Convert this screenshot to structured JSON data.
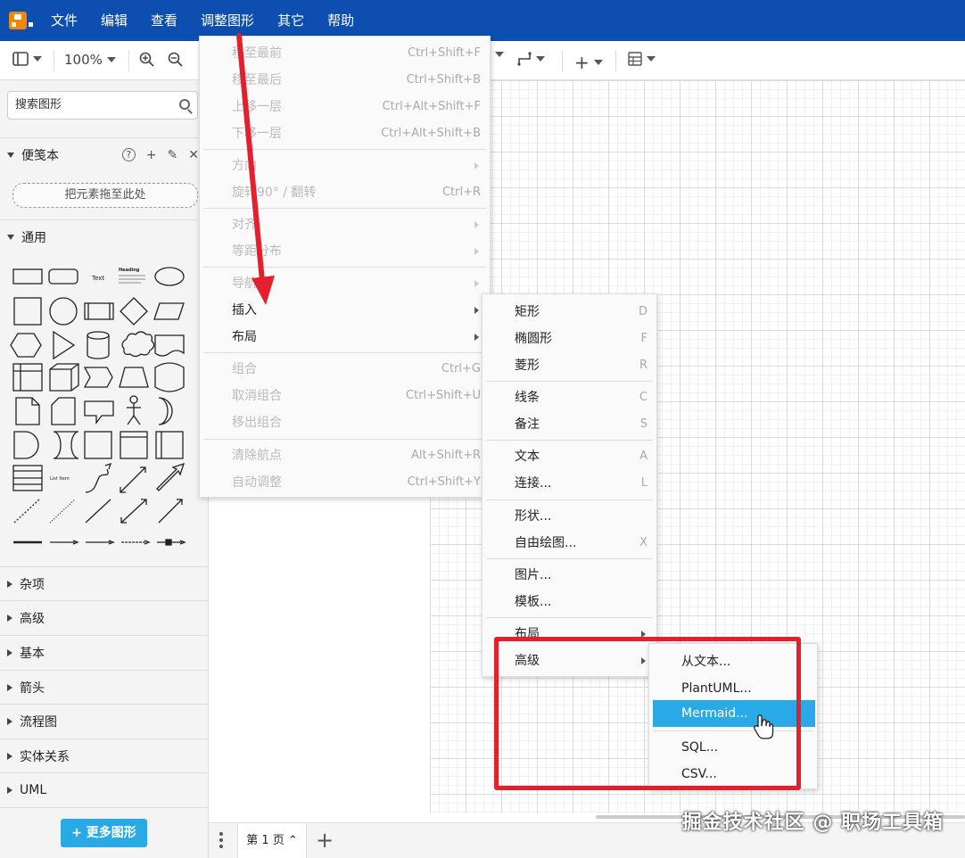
{
  "menubar": {
    "items": [
      "文件",
      "编辑",
      "查看",
      "调整图形",
      "其它",
      "帮助"
    ]
  },
  "toolbar": {
    "zoom": "100%"
  },
  "sidebar": {
    "search_placeholder": "搜索图形",
    "scratchpad_title": "便笺本",
    "dropzone_text": "把元素拖至此处",
    "general_title": "通用",
    "shape_text": "Text",
    "shape_heading": "Heading",
    "shape_list_item": "List Item",
    "sections": [
      "杂项",
      "高级",
      "基本",
      "箭头",
      "流程图",
      "实体关系",
      "UML"
    ],
    "more_shapes": "+ 更多图形"
  },
  "arrange_menu": {
    "items": [
      {
        "label": "移至最前",
        "shortcut": "Ctrl+Shift+F",
        "disabled": true
      },
      {
        "label": "移至最后",
        "shortcut": "Ctrl+Shift+B",
        "disabled": true
      },
      {
        "label": "上移一层",
        "shortcut": "Ctrl+Alt+Shift+F",
        "disabled": true
      },
      {
        "label": "下移一层",
        "shortcut": "Ctrl+Alt+Shift+B",
        "disabled": true
      },
      {
        "label": "方向",
        "shortcut": "",
        "disabled": true
      },
      {
        "label": "旋转90° / 翻转",
        "shortcut": "Ctrl+R",
        "disabled": true
      },
      {
        "label": "对齐",
        "shortcut": "",
        "disabled": true
      },
      {
        "label": "等距分布",
        "shortcut": "",
        "disabled": true
      },
      {
        "label": "导航",
        "shortcut": "",
        "disabled": true
      },
      {
        "label": "插入",
        "shortcut": "",
        "disabled": false
      },
      {
        "label": "布局",
        "shortcut": "",
        "disabled": false
      },
      {
        "label": "组合",
        "shortcut": "Ctrl+G",
        "disabled": true
      },
      {
        "label": "取消组合",
        "shortcut": "Ctrl+Shift+U",
        "disabled": true
      },
      {
        "label": "移出组合",
        "shortcut": "",
        "disabled": true
      },
      {
        "label": "清除航点",
        "shortcut": "Alt+Shift+R",
        "disabled": true
      },
      {
        "label": "自动调整",
        "shortcut": "Ctrl+Shift+Y",
        "disabled": true
      }
    ]
  },
  "insert_menu": {
    "items": [
      {
        "label": "矩形",
        "shortcut": "D"
      },
      {
        "label": "椭圆形",
        "shortcut": "F"
      },
      {
        "label": "菱形",
        "shortcut": "R"
      },
      {
        "label": "线条",
        "shortcut": "C"
      },
      {
        "label": "备注",
        "shortcut": "S"
      },
      {
        "label": "文本",
        "shortcut": "A"
      },
      {
        "label": "连接...",
        "shortcut": "L"
      },
      {
        "label": "形状...",
        "shortcut": ""
      },
      {
        "label": "自由绘图...",
        "shortcut": "X"
      },
      {
        "label": "图片...",
        "shortcut": ""
      },
      {
        "label": "模板...",
        "shortcut": ""
      },
      {
        "label": "布局",
        "shortcut": ""
      },
      {
        "label": "高级",
        "shortcut": ""
      }
    ]
  },
  "advanced_menu": {
    "items": [
      "从文本...",
      "PlantUML...",
      "Mermaid...",
      "SQL...",
      "CSV..."
    ]
  },
  "bottombar": {
    "page_tab": "第 1 页 ⌃"
  },
  "watermark": "掘金技术社区 @ 职场工具箱",
  "colors": {
    "menubar": "#0d4fb0",
    "highlight": "#29a9e6",
    "annotation_red": "#e5202e"
  }
}
